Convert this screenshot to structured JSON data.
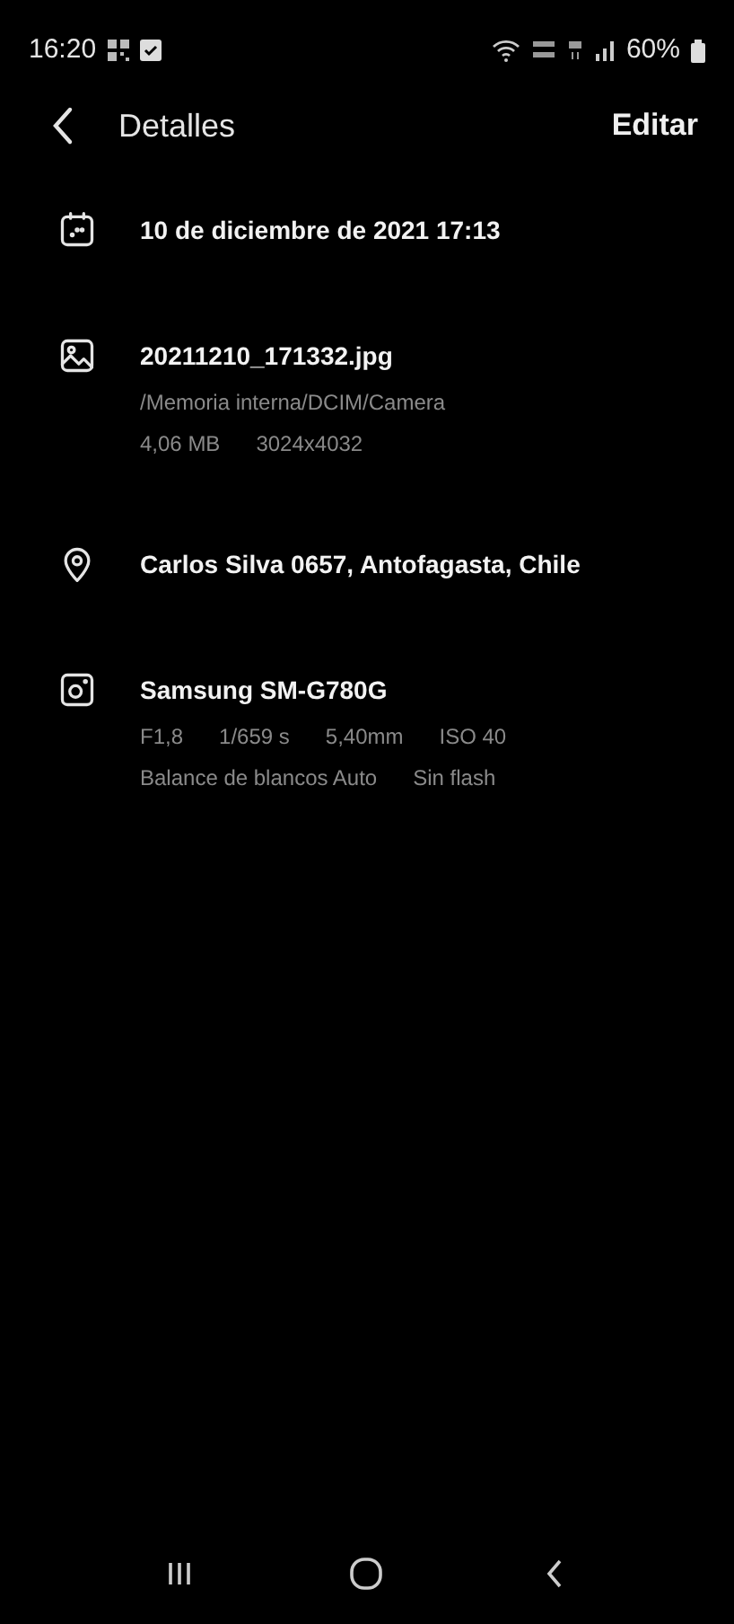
{
  "status_bar": {
    "time": "16:20",
    "battery": "60%"
  },
  "header": {
    "title": "Detalles",
    "action": "Editar"
  },
  "sections": [
    {
      "kind": "date",
      "title": "10 de diciembre de 2021 17:13"
    },
    {
      "kind": "image",
      "title": "20211210_171332.jpg",
      "lines": [
        [
          "/Memoria interna/DCIM/Camera"
        ],
        [
          "4,06 MB",
          "3024x4032"
        ]
      ]
    },
    {
      "kind": "location",
      "title": "Carlos Silva 0657, Antofagasta, Chile"
    },
    {
      "kind": "camera",
      "title": "Samsung SM-G780G",
      "lines": [
        [
          "F1,8",
          "1/659 s",
          "5,40mm",
          "ISO 40"
        ],
        [
          "Balance de blancos Auto",
          "Sin flash"
        ]
      ]
    }
  ]
}
